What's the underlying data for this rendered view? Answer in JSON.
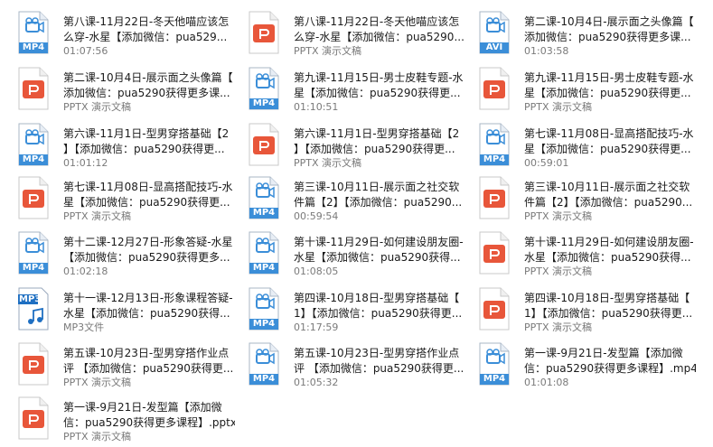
{
  "colors": {
    "video_blue": "#3b8ed8",
    "ppt_orange": "#e8563a",
    "mp3_blue": "#1e6fc2"
  },
  "files": [
    {
      "type": "video",
      "badge": "MP4",
      "line1": "第八课-11月22日-冬天他喵应该怎",
      "line2": "么穿-水星【添加微信：pua529...",
      "meta": "01:07:56"
    },
    {
      "type": "ppt",
      "badge": "",
      "line1": "第八课-11月22日-冬天他喵应该怎",
      "line2": "么穿-水星【添加微信：pua5290...",
      "meta": "PPTX 演示文稿"
    },
    {
      "type": "video",
      "badge": "AVI",
      "line1": "第二课-10月4日-展示面之头像篇【",
      "line2": "添加微信：pua5290获得更多课...",
      "meta": "01:03:58"
    },
    {
      "type": "ppt",
      "badge": "",
      "line1": "第二课-10月4日-展示面之头像篇【",
      "line2": "添加微信：pua5290获得更多课...",
      "meta": "PPTX 演示文稿"
    },
    {
      "type": "video",
      "badge": "MP4",
      "line1": "第九课-11月15日-男士皮鞋专题-水",
      "line2": "星【添加微信：pua5290获得更...",
      "meta": "01:10:51"
    },
    {
      "type": "ppt",
      "badge": "",
      "line1": "第九课-11月15日-男士皮鞋专题-水",
      "line2": "星【添加微信：pua5290获得更...",
      "meta": "PPTX 演示文稿"
    },
    {
      "type": "video",
      "badge": "MP4",
      "line1": "第六课-11月1日-型男穿搭基础【2",
      "line2": "】【添加微信：pua5290获得更...",
      "meta": "01:01:12"
    },
    {
      "type": "ppt",
      "badge": "",
      "line1": "第六课-11月1日-型男穿搭基础【2",
      "line2": "】【添加微信：pua5290获得更...",
      "meta": "PPTX 演示文稿"
    },
    {
      "type": "video",
      "badge": "MP4",
      "line1": "第七课-11月08日-显高搭配技巧-水",
      "line2": "星【添加微信：pua5290获得更...",
      "meta": "00:59:01"
    },
    {
      "type": "ppt",
      "badge": "",
      "line1": "第七课-11月08日-显高搭配技巧-水",
      "line2": "星【添加微信：pua5290获得更...",
      "meta": "PPTX 演示文稿"
    },
    {
      "type": "video",
      "badge": "MP4",
      "line1": "第三课-10月11日-展示面之社交软",
      "line2": "件篇【2】【添加微信：pua5290...",
      "meta": "00:59:54"
    },
    {
      "type": "ppt",
      "badge": "",
      "line1": "第三课-10月11日-展示面之社交软",
      "line2": "件篇【2】【添加微信：pua5290...",
      "meta": "PPTX 演示文稿"
    },
    {
      "type": "video",
      "badge": "MP4",
      "line1": "第十二课-12月27日-形象答疑-水星",
      "line2": "【添加微信：pua5290获得更多...",
      "meta": "01:02:18"
    },
    {
      "type": "video",
      "badge": "MP4",
      "line1": "第十课-11月29日-如何建设朋友圈-",
      "line2": "水星【添加微信：pua5290获得...",
      "meta": "01:08:05"
    },
    {
      "type": "ppt",
      "badge": "",
      "line1": "第十课-11月29日-如何建设朋友圈-",
      "line2": "水星【添加微信：pua5290获得...",
      "meta": "PPTX 演示文稿"
    },
    {
      "type": "mp3",
      "badge": "MP3",
      "line1": "第十一课-12月13日-形象课程答疑-",
      "line2": "水星【添加微信：pua5290获得...",
      "meta": "MP3文件"
    },
    {
      "type": "video",
      "badge": "MP4",
      "line1": "第四课-10月18日-型男穿搭基础【",
      "line2": "1】【添加微信：pua5290获得更...",
      "meta": "01:17:59"
    },
    {
      "type": "ppt",
      "badge": "",
      "line1": "第四课-10月18日-型男穿搭基础【",
      "line2": "1】【添加微信：pua5290获得更...",
      "meta": "PPTX 演示文稿"
    },
    {
      "type": "ppt",
      "badge": "",
      "line1": "第五课-10月23日-型男穿搭作业点",
      "line2": "评 【添加微信：pua5290获得更...",
      "meta": "PPTX 演示文稿"
    },
    {
      "type": "video",
      "badge": "MP4",
      "line1": "第五课-10月23日-型男穿搭作业点",
      "line2": "评 【添加微信：pua5290获得更...",
      "meta": "01:05:32"
    },
    {
      "type": "video",
      "badge": "MP4",
      "line1": "第一课-9月21日-发型篇【添加微",
      "line2": "信：pua5290获得更多课程】.mp4",
      "meta": "01:01:08"
    },
    {
      "type": "ppt",
      "badge": "",
      "line1": "第一课-9月21日-发型篇【添加微",
      "line2": "信：pua5290获得更多课程】.pptx",
      "meta": "PPTX 演示文稿"
    }
  ]
}
